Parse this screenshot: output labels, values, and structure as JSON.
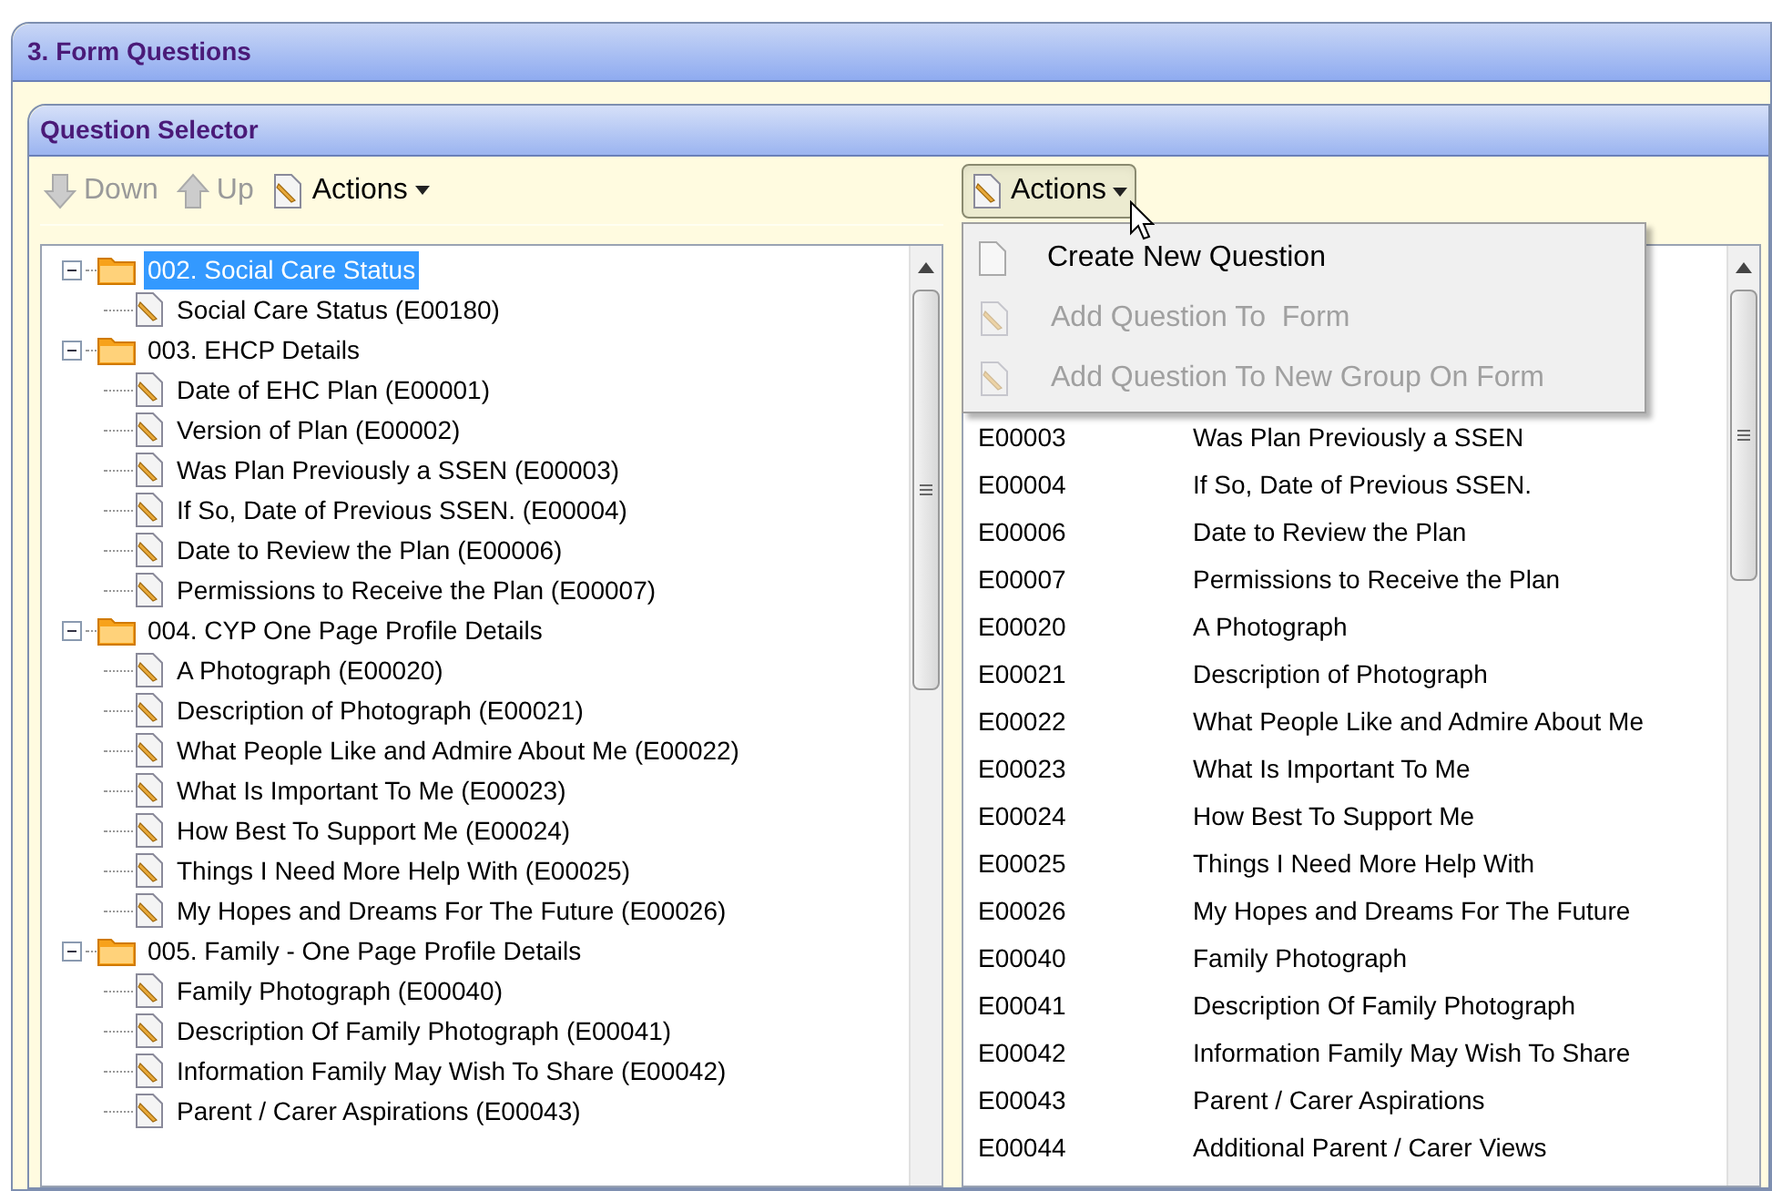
{
  "window": {
    "title": "3. Form Questions"
  },
  "panel": {
    "title": "Question Selector"
  },
  "left_toolbar": [
    {
      "label": "Down",
      "disabled": true,
      "kind": "down"
    },
    {
      "label": "Up",
      "disabled": true,
      "kind": "up"
    },
    {
      "label": "Actions",
      "disabled": false,
      "kind": "menu"
    }
  ],
  "tree": [
    {
      "label": "002. Social Care Status",
      "selected": true,
      "expanded": true,
      "children": [
        {
          "label": "Social Care Status (E00180)",
          "selected": false
        }
      ]
    },
    {
      "label": "003. EHCP Details",
      "selected": false,
      "expanded": true,
      "children": [
        {
          "label": "Date of EHC Plan (E00001)",
          "selected": false
        },
        {
          "label": "Version of Plan (E00002)",
          "selected": false
        },
        {
          "label": "Was Plan Previously a SSEN (E00003)",
          "selected": false
        },
        {
          "label": "If So, Date of Previous SSEN. (E00004)",
          "selected": false
        },
        {
          "label": "Date to Review the Plan (E00006)",
          "selected": false
        },
        {
          "label": "Permissions to Receive the Plan (E00007)",
          "selected": false
        }
      ]
    },
    {
      "label": "004. CYP One Page Profile Details",
      "selected": false,
      "expanded": true,
      "children": [
        {
          "label": "A Photograph (E00020)",
          "selected": false
        },
        {
          "label": "Description of Photograph (E00021)",
          "selected": false
        },
        {
          "label": "What People Like and Admire About Me (E00022)",
          "selected": false
        },
        {
          "label": "What Is Important To Me (E00023)",
          "selected": false
        },
        {
          "label": "How Best To Support Me (E00024)",
          "selected": false
        },
        {
          "label": "Things I Need More Help With (E00025)",
          "selected": false
        },
        {
          "label": "My Hopes and Dreams For The Future (E00026)",
          "selected": false
        }
      ]
    },
    {
      "label": "005. Family - One Page Profile Details",
      "selected": false,
      "expanded": true,
      "children": [
        {
          "label": "Family Photograph (E00040)",
          "selected": false
        },
        {
          "label": "Description Of Family Photograph (E00041)",
          "selected": false
        },
        {
          "label": "Information Family May Wish To Share (E00042)",
          "selected": false
        },
        {
          "label": "Parent / Carer Aspirations (E00043)",
          "selected": false
        }
      ]
    }
  ],
  "right_toolbar": {
    "label": "Actions",
    "pressed": true
  },
  "actions_menu": [
    {
      "label": "Create New Question",
      "disabled": false
    },
    {
      "label": "Add Question To  Form",
      "disabled": true
    },
    {
      "label": "Add Question To New Group On Form",
      "disabled": true
    }
  ],
  "question_list": [
    {
      "code": "E00003",
      "name": "Was Plan Previously a SSEN"
    },
    {
      "code": "E00004",
      "name": "If So, Date of Previous SSEN."
    },
    {
      "code": "E00006",
      "name": "Date to Review the Plan"
    },
    {
      "code": "E00007",
      "name": "Permissions to Receive the Plan"
    },
    {
      "code": "E00020",
      "name": "A Photograph"
    },
    {
      "code": "E00021",
      "name": "Description of Photograph"
    },
    {
      "code": "E00022",
      "name": "What People Like and Admire About Me"
    },
    {
      "code": "E00023",
      "name": "What Is Important To Me"
    },
    {
      "code": "E00024",
      "name": "How Best To Support Me"
    },
    {
      "code": "E00025",
      "name": "Things I Need More Help With"
    },
    {
      "code": "E00026",
      "name": "My Hopes and Dreams For The Future"
    },
    {
      "code": "E00040",
      "name": "Family Photograph"
    },
    {
      "code": "E00041",
      "name": "Description Of Family Photograph"
    },
    {
      "code": "E00042",
      "name": "Information Family May Wish To Share"
    },
    {
      "code": "E00043",
      "name": "Parent / Carer Aspirations"
    },
    {
      "code": "E00044",
      "name": "Additional Parent / Carer Views"
    }
  ]
}
